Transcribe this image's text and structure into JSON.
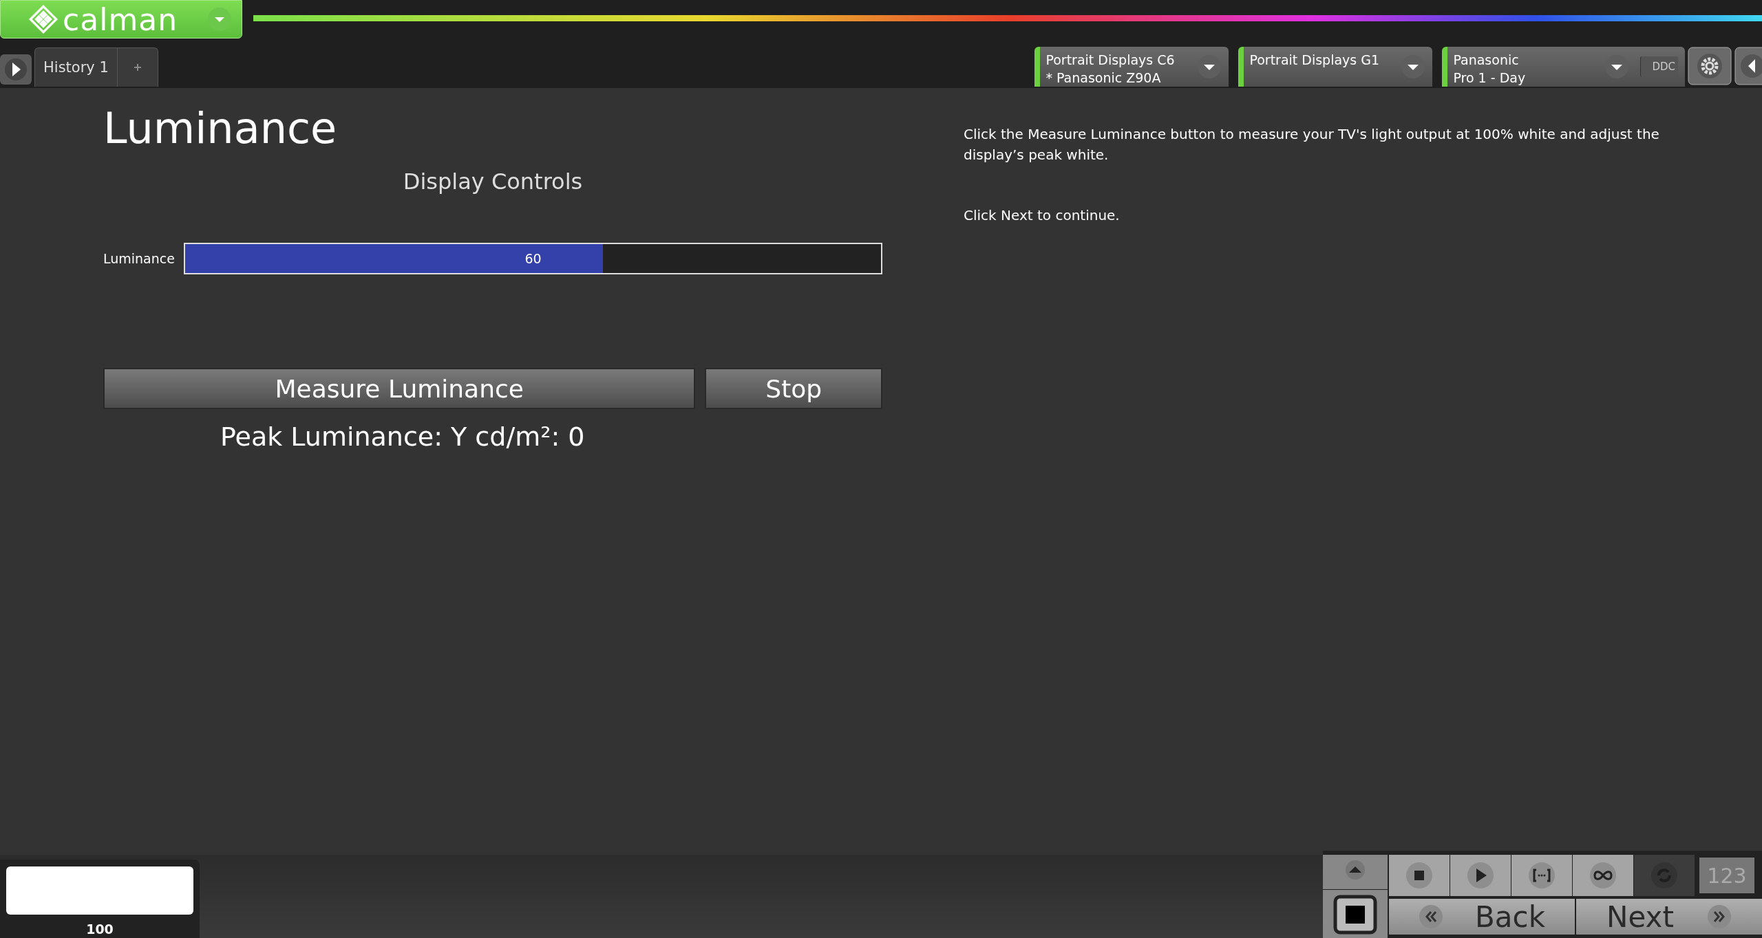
{
  "logo": {
    "text": "calman"
  },
  "history_tabs": [
    {
      "label": "History 1",
      "selected": true
    }
  ],
  "devices": [
    {
      "line1": "Portrait Displays C6",
      "line2": "* Panasonic Z90A"
    },
    {
      "line1": "Portrait Displays G1"
    },
    {
      "line1": "Panasonic",
      "line2": "Pro 1 - Day",
      "badge": "DDC"
    }
  ],
  "page": {
    "title": "Luminance",
    "section": "Display Controls",
    "controls": [
      {
        "label": "Luminance",
        "level": 0.6,
        "reading": "60"
      }
    ],
    "buttons": [
      {
        "label": "Measure Luminance"
      },
      {
        "label": "Stop"
      }
    ],
    "result": "Peak Luminance: Y cd/m²: 0",
    "instructions": [
      "Click the Measure Luminance button to measure your TV's light output at 100% white and adjust the display’s peak white.",
      "Click Next to continue."
    ]
  },
  "swatch": {
    "color": "#ffffff",
    "label": "100"
  },
  "transport": [
    {
      "kind": "stop",
      "active": true
    },
    {
      "kind": "play",
      "active": true
    },
    {
      "kind": "range",
      "active": true
    },
    {
      "kind": "loop",
      "active": true
    },
    {
      "kind": "refresh",
      "active": false
    }
  ],
  "counter": "123",
  "nav": {
    "back": "Back",
    "next": "Next"
  }
}
